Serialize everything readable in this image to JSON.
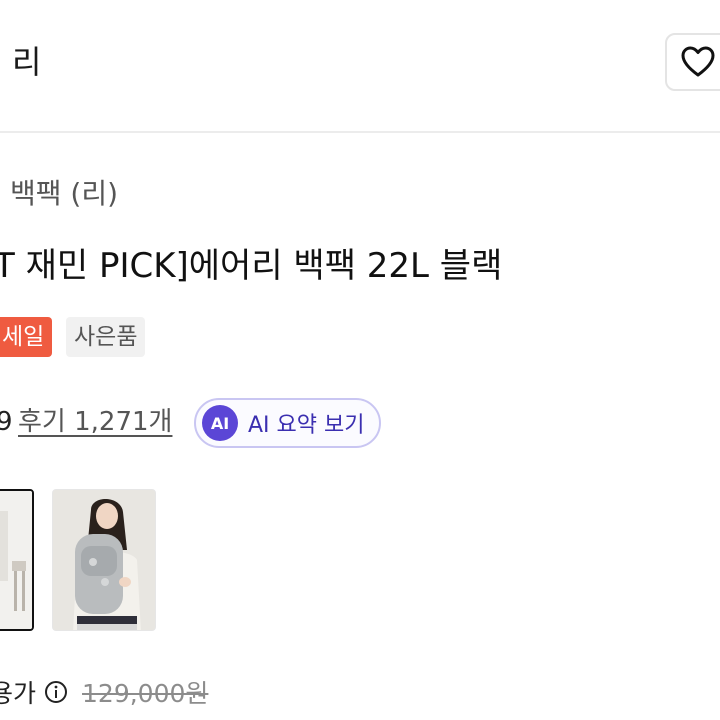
{
  "header": {
    "brand_name": "리",
    "wish_icon": "heart-icon"
  },
  "breadcrumb": "백팩 (리)",
  "product": {
    "title": "T 재민 PICK]에어리 백팩 22L 블랙",
    "badges": [
      "세일",
      "사은품"
    ],
    "rating_tail": "9",
    "review_link": "후기 1,271개",
    "ai_badge": "AI",
    "ai_summary_label": "AI 요약 보기",
    "price_label": "용가",
    "original_price": "129,000원"
  },
  "icons": {
    "wish": "heart-icon",
    "ai": "ai-badge-icon",
    "info": "info-icon"
  },
  "colors": {
    "sale_badge": "#ef5b40",
    "ai_accent": "#5b46d6",
    "ai_border": "#c9c6f2"
  }
}
